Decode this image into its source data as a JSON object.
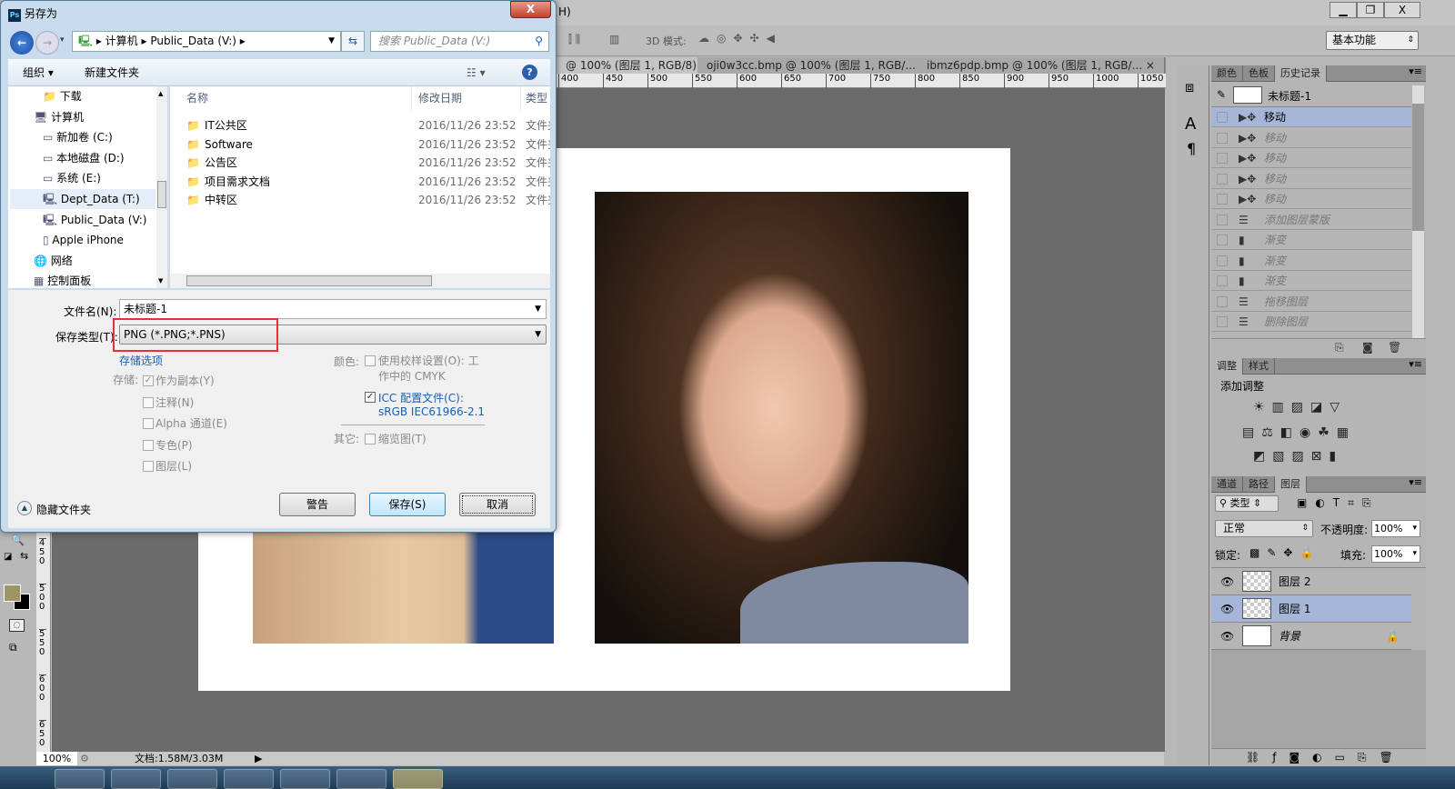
{
  "photoshop": {
    "menu_tail": "H)",
    "options": {
      "mode3d_label": "3D 模式:",
      "workspace": "基本功能"
    },
    "window_buttons": {
      "minimize": "▁",
      "restore": "❐",
      "close": "X"
    },
    "tabs": [
      {
        "label": "@ 100% (图层 1, RGB/8) *",
        "active": true
      },
      {
        "label": "oji0w3cc.bmp @ 100% (图层 1, RGB/...",
        "active": false
      },
      {
        "label": "ibmz6pdp.bmp @ 100% (图层 1, RGB/...",
        "active": false
      }
    ],
    "hruler_ticks": [
      "400",
      "450",
      "500",
      "550",
      "600",
      "650",
      "700",
      "750",
      "800",
      "850",
      "900",
      "950",
      "1000",
      "1050"
    ],
    "vruler_ticks": [
      "450",
      "500",
      "550",
      "600",
      "650"
    ],
    "status": {
      "zoom": "100%",
      "doc_info": "文档:1.58M/3.03M"
    },
    "foreground_color": "#9c9568",
    "background_color": "#000000",
    "history_panel": {
      "tabs": [
        {
          "label": "颜色"
        },
        {
          "label": "色板"
        },
        {
          "label": "历史记录",
          "active": true
        }
      ],
      "snapshot": "未标题-1",
      "items": [
        {
          "label": "移动",
          "icon": "move-icon",
          "selected": true
        },
        {
          "label": "移动",
          "icon": "move-icon"
        },
        {
          "label": "移动",
          "icon": "move-icon"
        },
        {
          "label": "移动",
          "icon": "move-icon"
        },
        {
          "label": "移动",
          "icon": "move-icon"
        },
        {
          "label": "添加图层蒙版",
          "icon": "document-icon"
        },
        {
          "label": "渐变",
          "icon": "gradient-icon"
        },
        {
          "label": "渐变",
          "icon": "gradient-icon"
        },
        {
          "label": "渐变",
          "icon": "gradient-icon"
        },
        {
          "label": "拖移图层",
          "icon": "document-icon"
        },
        {
          "label": "删除图层",
          "icon": "document-icon"
        }
      ]
    },
    "adjust_panel": {
      "tabs": [
        {
          "label": "调整",
          "active": true
        },
        {
          "label": "样式"
        }
      ],
      "title": "添加调整"
    },
    "layers_panel": {
      "tabs": [
        {
          "label": "通道"
        },
        {
          "label": "路径"
        },
        {
          "label": "图层",
          "active": true
        }
      ],
      "filter": "类型",
      "blend": "正常",
      "opacity_label": "不透明度:",
      "opacity": "100%",
      "lock_label": "锁定:",
      "fill_label": "填充:",
      "fill": "100%",
      "layers": [
        {
          "name": "图层 2",
          "selected": false
        },
        {
          "name": "图层 1",
          "selected": true
        },
        {
          "name": "背景",
          "locked": true
        }
      ]
    }
  },
  "dialog": {
    "title": "另存为",
    "close": "X",
    "breadcrumb": [
      "计算机",
      "Public_Data (V:)"
    ],
    "search_placeholder": "搜索 Public_Data (V:)",
    "toolbar": {
      "organize": "组织 ▾",
      "new_folder": "新建文件夹"
    },
    "nav": [
      {
        "label": "下载"
      },
      {
        "label": "计算机"
      },
      {
        "label": "新加卷 (C:)"
      },
      {
        "label": "本地磁盘 (D:)"
      },
      {
        "label": "系统 (E:)"
      },
      {
        "label": "Dept_Data (T:)",
        "selected": true
      },
      {
        "label": "Public_Data (V:)"
      },
      {
        "label": "Apple iPhone"
      },
      {
        "label": "网络"
      },
      {
        "label": "控制面板"
      }
    ],
    "columns": {
      "name": "名称",
      "date": "修改日期",
      "type": "类型"
    },
    "files": [
      {
        "name": "IT公共区",
        "date": "2016/11/26 23:52",
        "type": "文件夹"
      },
      {
        "name": "Software",
        "date": "2016/11/26 23:52",
        "type": "文件夹"
      },
      {
        "name": "公告区",
        "date": "2016/11/26 23:52",
        "type": "文件夹"
      },
      {
        "name": "项目需求文档",
        "date": "2016/11/26 23:52",
        "type": "文件夹"
      },
      {
        "name": "中转区",
        "date": "2016/11/26 23:52",
        "type": "文件夹"
      }
    ],
    "filename_label": "文件名(N):",
    "filename": "未标题-1",
    "type_label": "保存类型(T):",
    "type_value": "PNG (*.PNG;*.PNS)",
    "save_options_link": "存储选项",
    "store_label": "存储:",
    "store_options": [
      {
        "label": "作为副本(Y)",
        "checked": true
      },
      {
        "label": "注释(N)",
        "checked": false
      },
      {
        "label": "Alpha 通道(E)",
        "checked": false
      },
      {
        "label": "专色(P)",
        "checked": false
      },
      {
        "label": "图层(L)",
        "checked": false
      }
    ],
    "color_label": "颜色:",
    "proof_label": "使用校样设置(O): 工",
    "proof_label2": "作中的 CMYK",
    "icc_label": "ICC 配置文件(C):",
    "icc_value": "sRGB IEC61966-2.1",
    "icc_checked": true,
    "other_label": "其它:",
    "thumbnail_label": "缩览图(T)",
    "hide_folders": "隐藏文件夹",
    "buttons": {
      "warning": "警告",
      "save": "保存(S)",
      "cancel": "取消"
    },
    "highlight_color": "#e8303a"
  }
}
